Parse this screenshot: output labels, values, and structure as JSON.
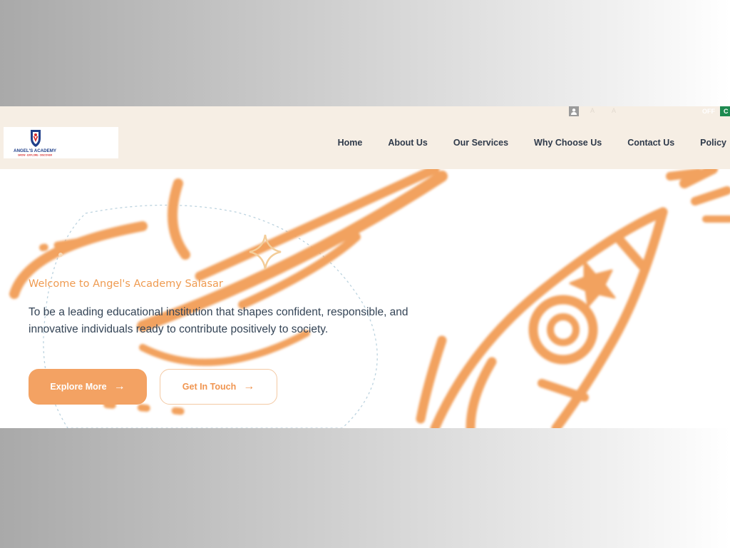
{
  "topbar": {
    "off_label": "OFF",
    "green_label": "C"
  },
  "logo": {
    "name": "ANGEL'S ACADEMY",
    "motto": "GROW · EXPLORE · DISCOVER"
  },
  "nav": {
    "items": [
      "Home",
      "About Us",
      "Our Services",
      "Why Choose Us",
      "Contact Us",
      "Policy"
    ]
  },
  "hero": {
    "welcome": "Welcome to Angel's Academy Salasar",
    "tagline": "To be a leading educational institution that shapes confident, responsible, and innovative individuals ready to contribute positively to society.",
    "primary_button": "Explore More",
    "secondary_button": "Get In Touch",
    "arrow_icon": "arrow-right-icon"
  },
  "colors": {
    "accent_orange": "#f3a263",
    "nav_bg": "#f6eee4",
    "text_dark": "#2f3a4a",
    "green": "#1e8a50"
  }
}
